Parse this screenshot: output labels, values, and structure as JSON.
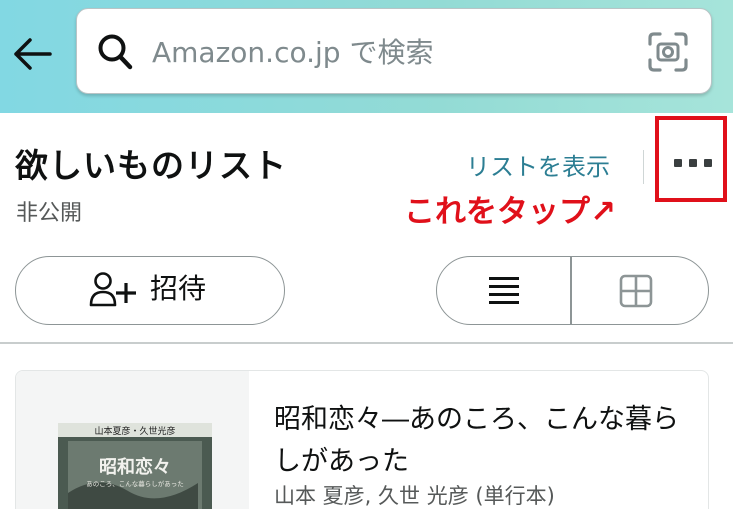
{
  "header": {
    "back_icon": "arrow-left-icon",
    "search": {
      "placeholder": "Amazon.co.jp で検索",
      "search_icon": "search-icon",
      "camera_icon": "camera-scan-icon"
    },
    "colors": {
      "gradient_start": "#82d8e3",
      "gradient_end": "#a6e4da"
    }
  },
  "list": {
    "title": "欲しいものリスト",
    "privacy": "非公開",
    "view_list_link": "リストを表示",
    "more_icon": "more-dots-icon",
    "annotation": "これをタップ↗",
    "highlight_color": "#e0101a",
    "link_color": "#2c7e93"
  },
  "actions": {
    "invite_icon": "add-person-icon",
    "invite_label": "招待",
    "list_view_icon": "list-view-icon",
    "grid_view_icon": "grid-view-icon",
    "selected_view": "list"
  },
  "items": [
    {
      "title": "昭和恋々―あのころ、こんな暮らしがあった",
      "author": "山本 夏彦, 久世 光彦 (単行本)",
      "cover_text": {
        "authors": "山本夏彦・久世光彦",
        "title": "昭和恋々",
        "subtitle": "あのころ、こんな暮らしがあった"
      }
    }
  ]
}
